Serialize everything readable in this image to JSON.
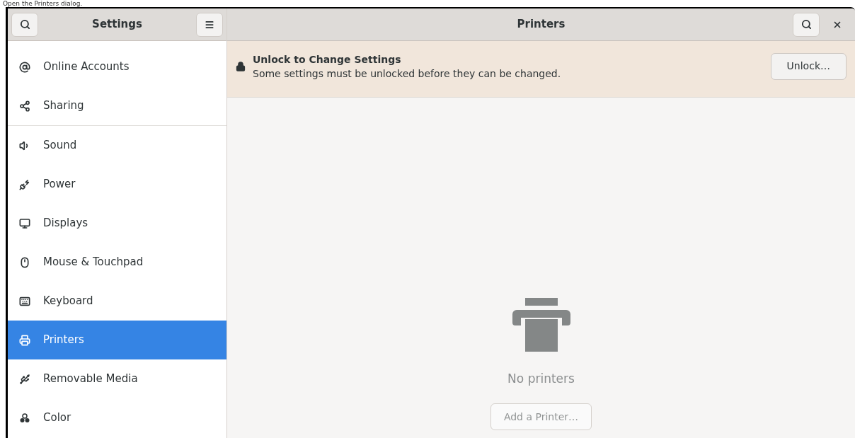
{
  "caption": "Open the Printers dialog.",
  "sidebar": {
    "title": "Settings",
    "groups": [
      [
        {
          "label": "Online Accounts",
          "selected": false
        },
        {
          "label": "Sharing",
          "selected": false
        }
      ],
      [
        {
          "label": "Sound",
          "selected": false
        },
        {
          "label": "Power",
          "selected": false
        },
        {
          "label": "Displays",
          "selected": false
        },
        {
          "label": "Mouse & Touchpad",
          "selected": false
        },
        {
          "label": "Keyboard",
          "selected": false
        },
        {
          "label": "Printers",
          "selected": true
        },
        {
          "label": "Removable Media",
          "selected": false
        },
        {
          "label": "Color",
          "selected": false
        }
      ]
    ]
  },
  "main": {
    "title": "Printers",
    "banner": {
      "title": "Unlock to Change Settings",
      "text": "Some settings must be unlocked before they can be changed.",
      "button": "Unlock…"
    },
    "empty_state": {
      "text": "No printers",
      "button": {
        "label": "Add a Printer…",
        "disabled": true
      }
    }
  }
}
